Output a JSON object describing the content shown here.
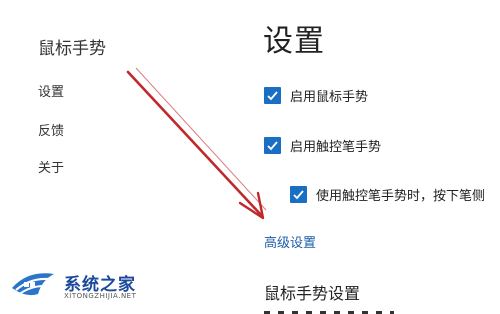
{
  "sidebar": {
    "title": "鼠标手势",
    "items": [
      {
        "label": "设置"
      },
      {
        "label": "反馈"
      },
      {
        "label": "关于"
      }
    ]
  },
  "main": {
    "title": "设置",
    "options": [
      {
        "label": "启用鼠标手势",
        "checked": true
      },
      {
        "label": "启用触控笔手势",
        "checked": true
      },
      {
        "label": "使用触控笔手势时，按下笔侧",
        "checked": true
      }
    ],
    "advanced_link": "高级设置",
    "section_heading": "鼠标手势设置"
  },
  "annotation": {
    "arrow_color": "#c0282a"
  },
  "watermark": {
    "title": "系统之家",
    "subtitle": "XITONGZHIJIA.NET"
  },
  "colors": {
    "accent": "#1a6fc4",
    "link": "#1c5fa8"
  }
}
